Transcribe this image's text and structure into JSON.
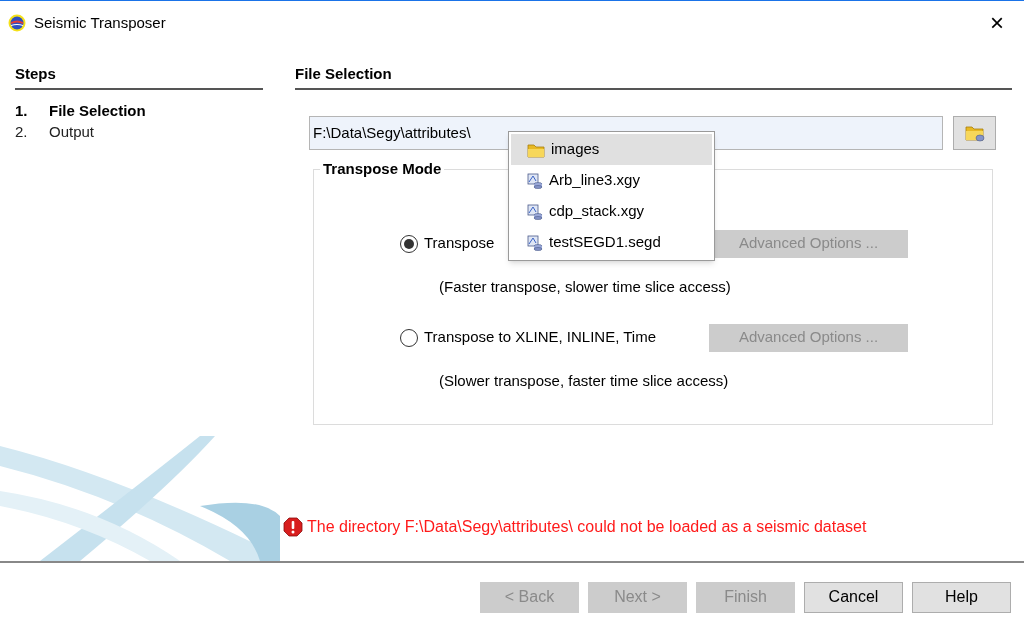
{
  "window": {
    "title": "Seismic Transposer",
    "close": "×"
  },
  "steps": {
    "heading": "Steps",
    "items": [
      {
        "number": "1.",
        "label": "File Selection",
        "selected": true
      },
      {
        "number": "2.",
        "label": "Output",
        "selected": false
      }
    ]
  },
  "panel": {
    "heading": "File Selection",
    "path_field": {
      "value": "F:\\Data\\Segy\\attributes\\"
    },
    "suggestions": [
      {
        "kind": "folder",
        "label": "images",
        "selected": true
      },
      {
        "kind": "dataset",
        "label": "Arb_line3.xgy",
        "selected": false
      },
      {
        "kind": "dataset",
        "label": "cdp_stack.xgy",
        "selected": false
      },
      {
        "kind": "dataset",
        "label": "testSEGD1.segd",
        "selected": false
      }
    ],
    "group_title": "Transpose Mode",
    "options": [
      {
        "label": "Transpose",
        "selected": true,
        "button": "Advanced Options ...",
        "button_disabled": true,
        "hint": "(Faster transpose, slower time slice access)"
      },
      {
        "label": "Transpose to XLINE, INLINE, Time",
        "selected": false,
        "button": "Advanced Options ...",
        "button_disabled": true,
        "hint": "(Slower transpose, faster time slice access)"
      }
    ],
    "error": "The directory F:\\Data\\Segy\\attributes\\ could not be loaded as a seismic dataset"
  },
  "buttons": [
    {
      "label": "< Back",
      "disabled": true
    },
    {
      "label": "Next >",
      "disabled": true
    },
    {
      "label": "Finish",
      "disabled": true
    },
    {
      "label": "Cancel",
      "disabled": false
    },
    {
      "label": "Help",
      "disabled": false
    }
  ]
}
